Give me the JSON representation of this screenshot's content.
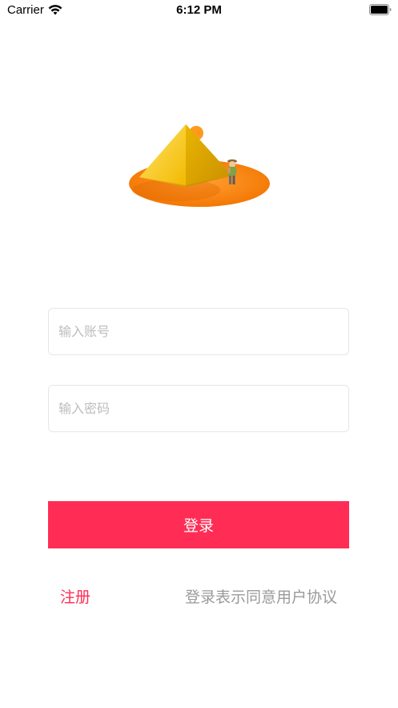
{
  "status_bar": {
    "carrier": "Carrier",
    "time": "6:12 PM",
    "icons": [
      "wifi-icon",
      "battery-icon"
    ]
  },
  "illustration": {
    "name": "pyramid-desert-illustration",
    "colors": {
      "sand": "#ff8c1a",
      "pyramid_light": "#ffd21f",
      "pyramid_dark": "#d9a200",
      "sun": "#ff9a1f"
    }
  },
  "login_form": {
    "account_placeholder": "输入账号",
    "account_value": "",
    "password_placeholder": "输入密码",
    "password_value": "",
    "login_label": "登录"
  },
  "footer": {
    "register_label": "注册",
    "agreement_label": "登录表示同意用户协议"
  },
  "colors": {
    "accent": "#ff2d55",
    "muted_text": "#9a9a9a",
    "placeholder": "#bdbdbd",
    "field_border": "#e6e6e6"
  }
}
